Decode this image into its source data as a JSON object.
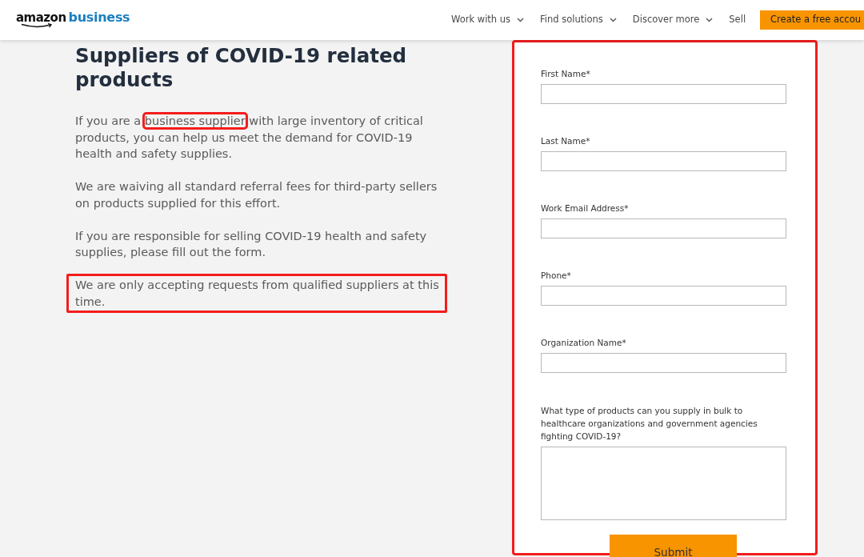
{
  "header": {
    "logo": {
      "brand": "amazon",
      "product": "business"
    },
    "nav": [
      {
        "label": "Work with us",
        "dropdown": true
      },
      {
        "label": "Find solutions",
        "dropdown": true
      },
      {
        "label": "Discover more",
        "dropdown": true
      },
      {
        "label": "Sell",
        "dropdown": false
      }
    ],
    "cta": "Create a free accou"
  },
  "intro": {
    "title": "Suppliers of COVID-19 related products",
    "paragraphs": [
      {
        "highlighted": false,
        "segments": [
          {
            "text": "If you are a ",
            "highlighted": false
          },
          {
            "text": "business supplier",
            "highlighted": true
          },
          {
            "text": " with large inventory of critical products, you can help us meet the demand for COVID-19 health and safety supplies.",
            "highlighted": false
          }
        ]
      },
      {
        "highlighted": false,
        "segments": [
          {
            "text": "We are waiving all standard referral fees for third-party sellers on products supplied for this effort.",
            "highlighted": false
          }
        ]
      },
      {
        "highlighted": false,
        "segments": [
          {
            "text": "If you are responsible for selling COVID-19 health and safety supplies, please fill out the form.",
            "highlighted": false
          }
        ]
      },
      {
        "highlighted": true,
        "segments": [
          {
            "text": "We are only accepting requests from qualified suppliers at this time.",
            "highlighted": false
          }
        ]
      }
    ]
  },
  "form": {
    "highlighted": true,
    "fields": [
      {
        "kind": "text",
        "label": "First Name*"
      },
      {
        "kind": "text",
        "label": "Last Name*"
      },
      {
        "kind": "text",
        "label": "Work Email Address*"
      },
      {
        "kind": "text",
        "label": "Phone*"
      },
      {
        "kind": "text",
        "label": "Organization Name*"
      },
      {
        "kind": "textarea",
        "label": "What type of products can you supply in bulk to healthcare organizations and government agencies fighting COVID-19?"
      }
    ],
    "submit": "Submit"
  }
}
